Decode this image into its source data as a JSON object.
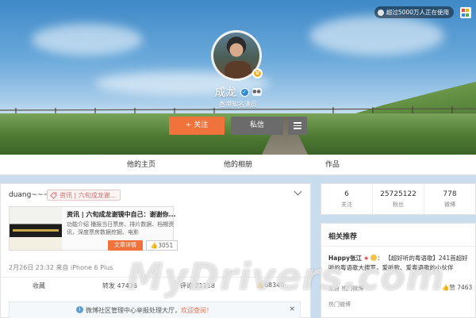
{
  "header": {
    "users_badge": "超过5000万人正在使用",
    "profile_name": "成龙",
    "profile_subtitle": "香港知名演员",
    "follow_label": "+ 关注",
    "message_label": "私信",
    "icons": {
      "verified": "verified-badge-icon",
      "vip": "vip-icon",
      "more": "menu-icon"
    }
  },
  "nav": {
    "tabs": [
      {
        "label": "他的主页"
      },
      {
        "label": "他的相册"
      },
      {
        "label": "作品"
      }
    ]
  },
  "post": {
    "author": "duang~~~",
    "topic": "资讯 | 六旬成龙谢...",
    "article": {
      "title": "资讯 | 六旬成龙谢镜中自己：谢谢你...",
      "desc": "功能介绍 播报当日票房、排片数据、档期资讯，深度票房数据挖掘、电影",
      "button": "文章详情",
      "likes": "3051"
    },
    "meta": "2月26日 23:32 来自 iPhone 6 Plus",
    "actions": {
      "favorite": "收藏",
      "repost": "转发 47436",
      "comment": "评论 21118",
      "like": "68340"
    },
    "notice": {
      "text": "微博社区管理中心举报处理大厅，",
      "link": "欢迎查阅！",
      "close": "×"
    }
  },
  "stats": [
    {
      "num": "6",
      "label": "关注"
    },
    {
      "num": "25725122",
      "label": "粉丝"
    },
    {
      "num": "778",
      "label": "微博"
    }
  ],
  "recommend": {
    "title": "相关推荐",
    "item": {
      "user": "Happy张江",
      "body": "【超好听的粤语歌】241首超好听的粤语歌大搜罗，爱听歌、爱粤语歌的小伙伴",
      "meta": "来自 热门微博",
      "likes": "赞 7463",
      "footer": "热门微博"
    }
  },
  "watermark": "MyDrivers.com",
  "colors": {
    "accent": "#f0733c",
    "grey_button": "#6b6b6b",
    "page_bg": "#c9ddee"
  }
}
